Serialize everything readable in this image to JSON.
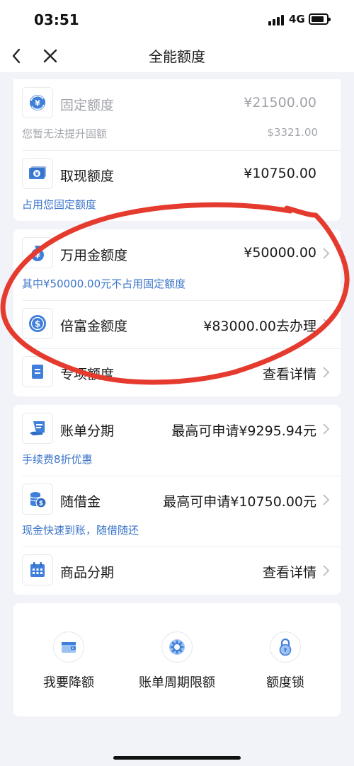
{
  "status": {
    "time": "03:51",
    "network": "4G"
  },
  "nav": {
    "title": "全能额度"
  },
  "limits_card": {
    "fixed": {
      "icon": "yuan-refresh-icon",
      "title": "固定额度",
      "value": "¥21500.00",
      "note": "您暂无法提升固额",
      "note_value": "$3321.00"
    },
    "cash": {
      "icon": "cash-note-icon",
      "title": "取现额度",
      "value": "¥10750.00",
      "note": "占用您固定额度"
    }
  },
  "special_card": {
    "wanyong": {
      "icon": "money-bag-icon",
      "title": "万用金额度",
      "value": "¥50000.00",
      "note": "其中¥50000.00元不占用固定额度"
    },
    "beifu": {
      "icon": "dollar-coin-icon",
      "title": "倍富金额度",
      "value": "¥83000.00去办理"
    },
    "zhuanxiang": {
      "icon": "document-icon",
      "title": "专项额度",
      "value": "查看详情"
    }
  },
  "installment_card": {
    "bill": {
      "icon": "bill-scroll-icon",
      "title": "账单分期",
      "value": "最高可申请¥9295.94元",
      "note": "手续费8折优惠"
    },
    "suijie": {
      "icon": "coin-stack-icon",
      "title": "随借金",
      "value": "最高可申请¥10750.00元",
      "note": "现金快速到账，随借随还"
    },
    "goods": {
      "icon": "calendar-icon",
      "title": "商品分期",
      "value": "查看详情"
    }
  },
  "shortcuts": [
    {
      "icon": "wallet-down-icon",
      "label": "我要降额"
    },
    {
      "icon": "gear-cycle-icon",
      "label": "账单周期限额"
    },
    {
      "icon": "lock-icon",
      "label": "额度锁"
    }
  ],
  "colors": {
    "accent": "#3a74c9",
    "icon_blue": "#3f7fd9",
    "annotation_red": "#e53b2f",
    "background": "#f1f3f8"
  }
}
